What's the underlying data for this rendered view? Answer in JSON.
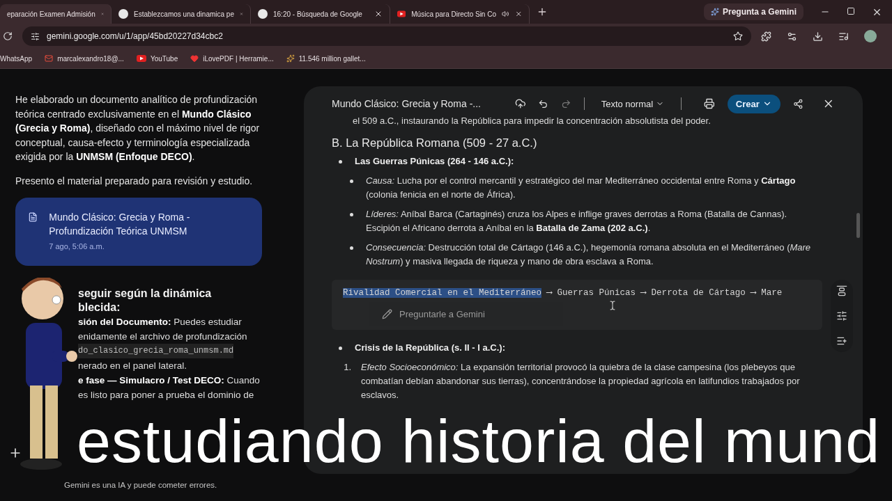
{
  "browser": {
    "tabs": [
      {
        "title": "eparación Examen Admisión",
        "kind": "page",
        "selected": true,
        "audio": false
      },
      {
        "title": "Establezcamos una dinamica pe",
        "kind": "google",
        "selected": false,
        "audio": false
      },
      {
        "title": "16:20 - Búsqueda de Google",
        "kind": "google",
        "selected": false,
        "audio": false
      },
      {
        "title": "Música para Directo Sin Co",
        "kind": "video",
        "selected": false,
        "audio": true
      }
    ],
    "gemini_button": "Pregunta a Gemini",
    "address": "gemini.google.com/u/1/app/45bd20227d34cbc2",
    "bookmarks": [
      {
        "label": "WhatsApp",
        "kind": "plain"
      },
      {
        "label": "marcalexandro18@...",
        "kind": "mail"
      },
      {
        "label": "YouTube",
        "kind": "video"
      },
      {
        "label": "iLovePDF | Herramie...",
        "kind": "heart"
      },
      {
        "label": "11.546 million gallet...",
        "kind": "star"
      }
    ]
  },
  "chat": {
    "paragraphs": [
      "He elaborado un documento analítico de profundización teórica centrado exclusivamente en el **Mundo Clásico (Grecia y Roma)**, diseñado con el máximo nivel de rigor conceptual, causa-efecto y terminología especializada exigida por la **UNMSM (Enfoque DECO)**.",
      "Presento el material preparado para revisión y estudio."
    ],
    "doc_card": {
      "title": "Mundo Clásico: Grecia y Roma - Profundización Teórica UNMSM",
      "time": "7 ago, 5:06 a.m."
    },
    "partial_lines": [
      {
        "text": "seguir según la dinámica",
        "kind": "heading"
      },
      {
        "text": "blecida:",
        "kind": "heading"
      },
      {
        "text": "**sión del Documento:** Puedes estudiar",
        "kind": "text"
      },
      {
        "text": "enidamente el archivo de profundización",
        "kind": "text"
      },
      {
        "text": "do_clasico_grecia_roma_unmsm.md",
        "kind": "code"
      },
      {
        "text": "nerado en el panel lateral.",
        "kind": "text"
      },
      {
        "text": "**e fase — Simulacro / Test DECO:** Cuando",
        "kind": "text"
      },
      {
        "text": "es listo para poner a prueba el dominio de",
        "kind": "text"
      }
    ],
    "disclaimer": "Gemini es una IA y puede cometer errores."
  },
  "document": {
    "title": "Mundo Clásico: Grecia y Roma -...",
    "style_select": "Texto normal",
    "create_button": "Crear",
    "blocks": [
      {
        "kind": "continuation",
        "text": "el 509 a.C., instaurando la República para impedir la concentración absolutista del poder."
      },
      {
        "kind": "heading",
        "text": "B. La República Romana (509 - 27 a.C.)"
      },
      {
        "kind": "bullet",
        "text": "Las Guerras Púnicas (264 - 146 a.C.):"
      },
      {
        "kind": "sub_bullet",
        "text": "*Causa:* Lucha por el control mercantil y estratégico del mar Mediterráneo occidental entre Roma y **Cártago** (colonia fenicia en el norte de África)."
      },
      {
        "kind": "sub_bullet",
        "text": "*Líderes:* Aníbal Barca (Cartaginés) cruza los Alpes e inflige graves derrotas a Roma (Batalla de Cannas). Escipión el Africano derrota a Aníbal en la **Batalla de Zama (202 a.C.)**."
      },
      {
        "kind": "sub_bullet",
        "text": "*Consecuencia:* Destrucción total de Cártago (146 a.C.), hegemonía romana absoluta en el Mediterráneo (*Mare Nostrum*) y masiva llegada de riqueza y mano de obra esclava a Roma."
      },
      {
        "kind": "code",
        "segments": [
          {
            "text": "Rivalidad Comercial en el Mediterráneo",
            "selected": true
          },
          {
            "text": " ⟶ Guerras Púnicas ⟶ Derrota de Cártago ⟶ Mare",
            "selected": false
          }
        ],
        "popup": "Preguntarle a Gemini"
      },
      {
        "kind": "bullet",
        "text": "Crisis de la República (s. II - I a.C.):"
      },
      {
        "kind": "numbered",
        "marker": "1.",
        "text": "*Efecto Socioeconómico:* La expansión territorial provocó la quiebra de la clase campesina (los plebeyos que combatían debían abandonar sus tierras), concentrándose la propiedad agrícola en latifundios trabajados por esclavos."
      }
    ]
  },
  "caption": "estudiando historia del mund"
}
